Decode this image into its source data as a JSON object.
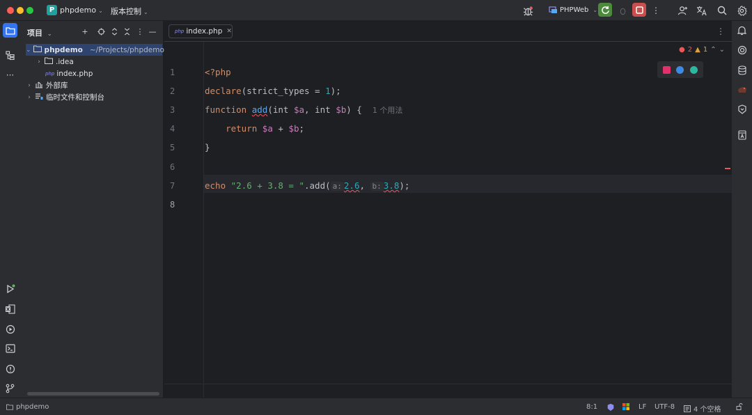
{
  "titlebar": {
    "project_badge": "P",
    "project_name": "phpdemo",
    "vcs_menu": "版本控制",
    "run_config": "PHPWeb",
    "colors": {
      "run": "#4e8a3e",
      "stop": "#c94f4f",
      "badge": "#21a0a0"
    }
  },
  "project_panel": {
    "title": "项目",
    "tree": [
      {
        "name": "phpdemo",
        "path": "~/Projects/phpdemo",
        "type": "folder",
        "expanded": true,
        "selected": true
      },
      {
        "name": ".idea",
        "type": "folder",
        "expanded": false
      },
      {
        "name": "index.php",
        "type": "php-file"
      },
      {
        "name": "外部库",
        "type": "library",
        "expanded": false
      },
      {
        "name": "临时文件和控制台",
        "type": "scratches",
        "expanded": false
      }
    ],
    "php_tag": "php"
  },
  "editor": {
    "tab": {
      "label": "index.php",
      "icon_tag": "php"
    },
    "line_numbers": [
      "1",
      "2",
      "3",
      "4",
      "5",
      "6",
      "7",
      "8"
    ],
    "lines": {
      "l1": {
        "open": "<?php"
      },
      "l2": {
        "fn": "declare",
        "p1": "(strict_types = ",
        "num": "1",
        "p2": ");"
      },
      "l3": {
        "kw": "function",
        "sp": " ",
        "fn": "add",
        "p1": "(int ",
        "v1": "$a",
        "p2": ", int ",
        "v2": "$b",
        "p3": ") {",
        "usage": "1 个用法"
      },
      "l4": {
        "kw": "return",
        "v1": "$a",
        "op": " + ",
        "v2": "$b",
        "end": ";"
      },
      "l5": {
        "brace": "}"
      },
      "l7": {
        "kw": "echo",
        "str": "\"2.6 + 3.8 = \"",
        "dot": ".",
        "fn": "add",
        "open": "(",
        "hint_a": "a:",
        "num1": "2.6",
        "comma": ", ",
        "hint_b": "b:",
        "num2": "3.8",
        "close": ");"
      }
    },
    "inspections": {
      "errors": "2",
      "warnings": "1"
    }
  },
  "statusbar": {
    "project": "phpdemo",
    "position": "8:1",
    "line_sep": "LF",
    "encoding": "UTF-8",
    "indent": "4 个空格"
  }
}
